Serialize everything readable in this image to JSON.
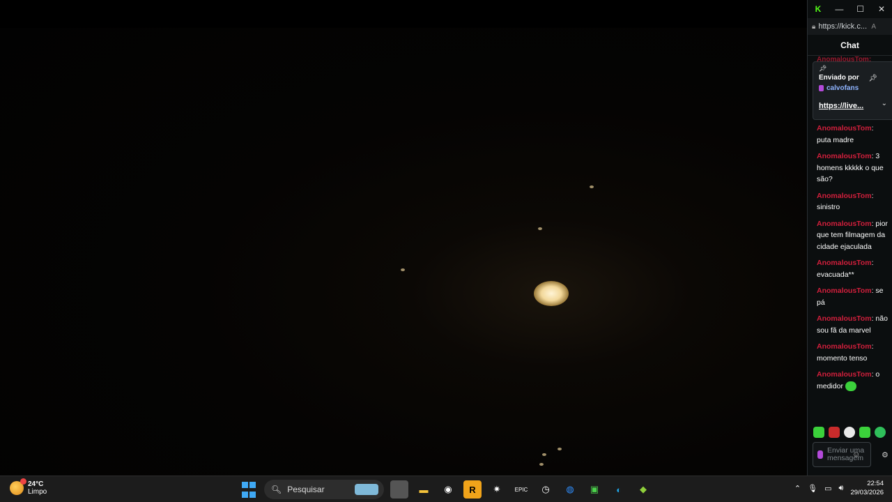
{
  "browser": {
    "url": "https://kick.c...",
    "reader_mode_label": "A"
  },
  "chat": {
    "title": "Chat",
    "cut_off_name": "AnomalousTom:",
    "pinned": {
      "sent_by_label": "Enviado por",
      "user": "calvofans",
      "link": "https://live..."
    },
    "messages": [
      {
        "user": "AnomalousTom",
        "text": ": puta madre"
      },
      {
        "user": "AnomalousTom",
        "text": ": 3 homens kkkkk o que são?"
      },
      {
        "user": "AnomalousTom",
        "text": ": sinistro"
      },
      {
        "user": "AnomalousTom",
        "text": ": pior que tem filmagem da cidade ejaculada"
      },
      {
        "user": "AnomalousTom",
        "text": ": evacuada**"
      },
      {
        "user": "AnomalousTom",
        "text": ": se pá"
      },
      {
        "user": "AnomalousTom",
        "text": ": não sou fã da marvel"
      },
      {
        "user": "AnomalousTom",
        "text": ": momento tenso"
      },
      {
        "user": "AnomalousTom",
        "text": ": o medidor"
      }
    ],
    "input_placeholder": "Enviar uma mensagem"
  },
  "taskbar": {
    "weather_temp": "24°C",
    "weather_cond": "Limpo",
    "search_label": "Pesquisar",
    "time": "22:54",
    "date": "29/03/2026"
  },
  "colors": {
    "chat_name": "#d21f3c",
    "accent_green": "#3bd13b",
    "taskbar_bg": "#1c1c1c"
  }
}
